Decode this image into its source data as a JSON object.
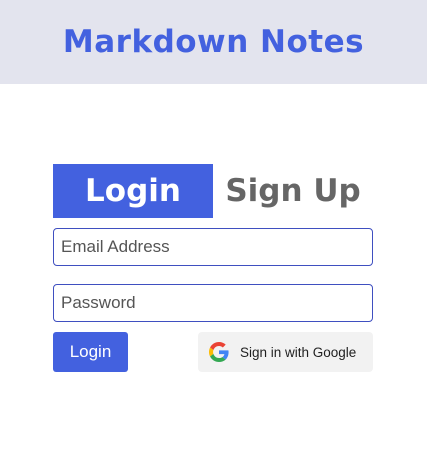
{
  "header": {
    "title": "Markdown Notes"
  },
  "tabs": [
    {
      "label": "Login",
      "active": true
    },
    {
      "label": "Sign Up",
      "active": false
    }
  ],
  "form": {
    "email_placeholder": "Email Address",
    "email_value": "",
    "password_placeholder": "Password",
    "password_value": "",
    "login_label": "Login",
    "google_label": "Sign in with Google",
    "google_icon": "google-logo-icon"
  },
  "colors": {
    "accent": "#4361df",
    "header_bg": "#e3e4ee",
    "inactive_tab": "#666666",
    "google_button_bg": "#f2f2f2"
  }
}
